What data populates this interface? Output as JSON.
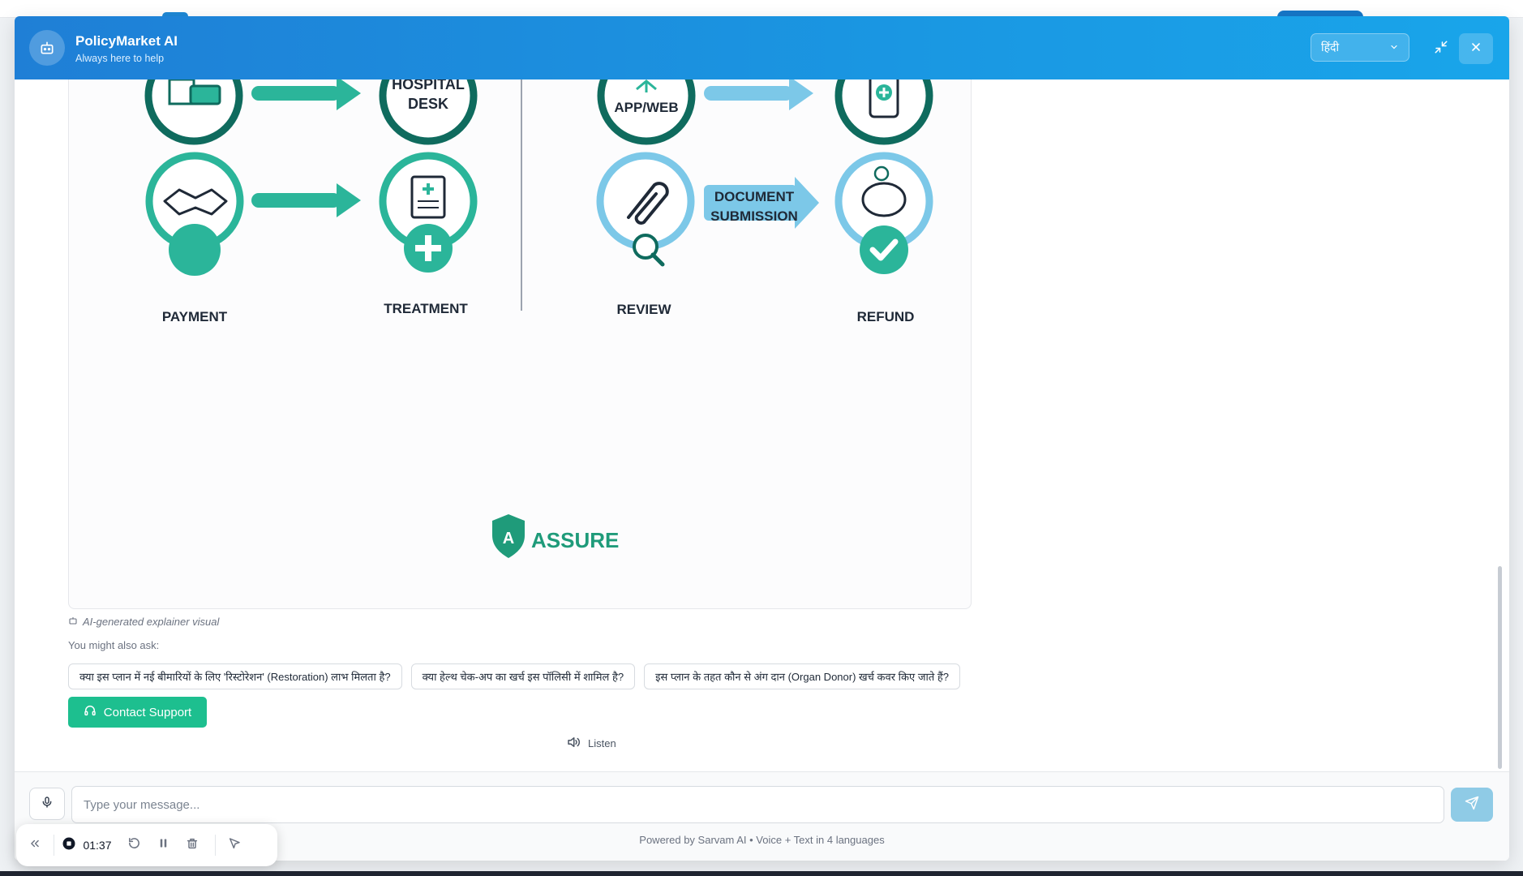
{
  "header": {
    "title": "PolicyMarket AI",
    "subtitle": "Always here to help",
    "language": "हिंदी",
    "bot_icon": "bot-icon",
    "minimize_icon": "minimize-icon",
    "close_icon": "close-icon"
  },
  "visual": {
    "left_flow": {
      "desk_label_line1": "HOSPITAL",
      "desk_label_line2": "DESK",
      "payment_label": "PAYMENT",
      "treatment_label": "TREATMENT"
    },
    "right_flow": {
      "app_label": "APP/WEB",
      "review_label": "REVIEW",
      "doc_label_line1": "DOCUMENT",
      "doc_label_line2": "SUBMISSION",
      "refund_label": "REFUND"
    },
    "logo_text": "ASSURE",
    "colors": {
      "teal_dark": "#0f6b5e",
      "teal": "#2bb59a",
      "light_blue": "#7cc8e8",
      "assure_green": "#1f9b7a"
    }
  },
  "caption": "AI-generated explainer visual",
  "suggestions": {
    "label": "You might also ask:",
    "chips": [
      "क्या इस प्लान में नई बीमारियों के लिए 'रिस्टोरेशन' (Restoration) लाभ मिलता है?",
      "क्या हेल्थ चेक-अप का खर्च इस पॉलिसी में शामिल है?",
      "इस प्लान के तहत कौन से अंग दान (Organ Donor) खर्च कवर किए जाते हैं?"
    ]
  },
  "support_button": "Contact Support",
  "listen_label": "Listen",
  "input": {
    "placeholder": "Type your message..."
  },
  "footer_text": "Powered by Sarvam AI • Voice + Text in 4 languages",
  "recorder": {
    "time": "01:37"
  },
  "accent_colors": {
    "header": "#1f7fd6",
    "support": "#1dbf8f",
    "send": "#8fcbe6"
  }
}
